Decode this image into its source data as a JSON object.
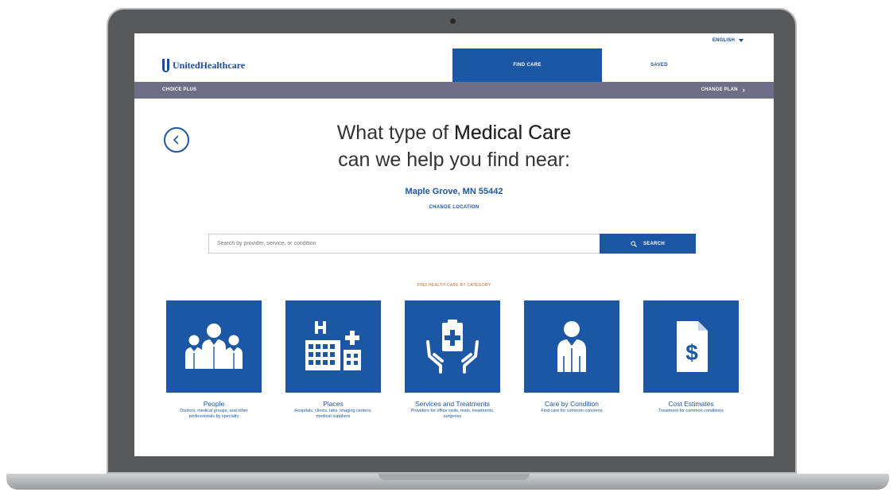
{
  "top_bar": {
    "language": "ENGLISH"
  },
  "header": {
    "brand": "UnitedHealthcare",
    "tabs": [
      {
        "label": "FIND CARE",
        "active": true
      },
      {
        "label": "SAVED",
        "active": false
      }
    ]
  },
  "plan_bar": {
    "plan_name": "CHOICE PLUS",
    "change_plan": "CHANGE PLAN"
  },
  "main": {
    "headline_line1_pre": "What type of ",
    "headline_line1_bold": "Medical Care",
    "headline_line2": "can we help you find near:",
    "location": "Maple Grove, MN 55442",
    "change_location": "CHANGE LOCATION"
  },
  "search": {
    "placeholder": "Search by provider, service, or condition",
    "button_label": "SEARCH"
  },
  "categories_heading": "FIND HEALTH CARE BY CATEGORY",
  "categories": [
    {
      "icon": "people-icon",
      "title": "People",
      "description": "Doctors, medical groups, and other professionals by specialty"
    },
    {
      "icon": "places-icon",
      "title": "Places",
      "description": "Hospitals, clinics, labs, imaging centers, medical suppliers"
    },
    {
      "icon": "services-icon",
      "title": "Services and Treatments",
      "description": "Providers for office visits, tests, treatments, surgeries"
    },
    {
      "icon": "condition-icon",
      "title": "Care by Condition",
      "description": "Find care for common concerns"
    },
    {
      "icon": "cost-icon",
      "title": "Cost Estimates",
      "description": "Treatment for common conditions"
    }
  ],
  "colors": {
    "brand_blue": "#1c57a5",
    "plan_bar": "#6d6e87",
    "category_heading": "#c06a2c"
  }
}
